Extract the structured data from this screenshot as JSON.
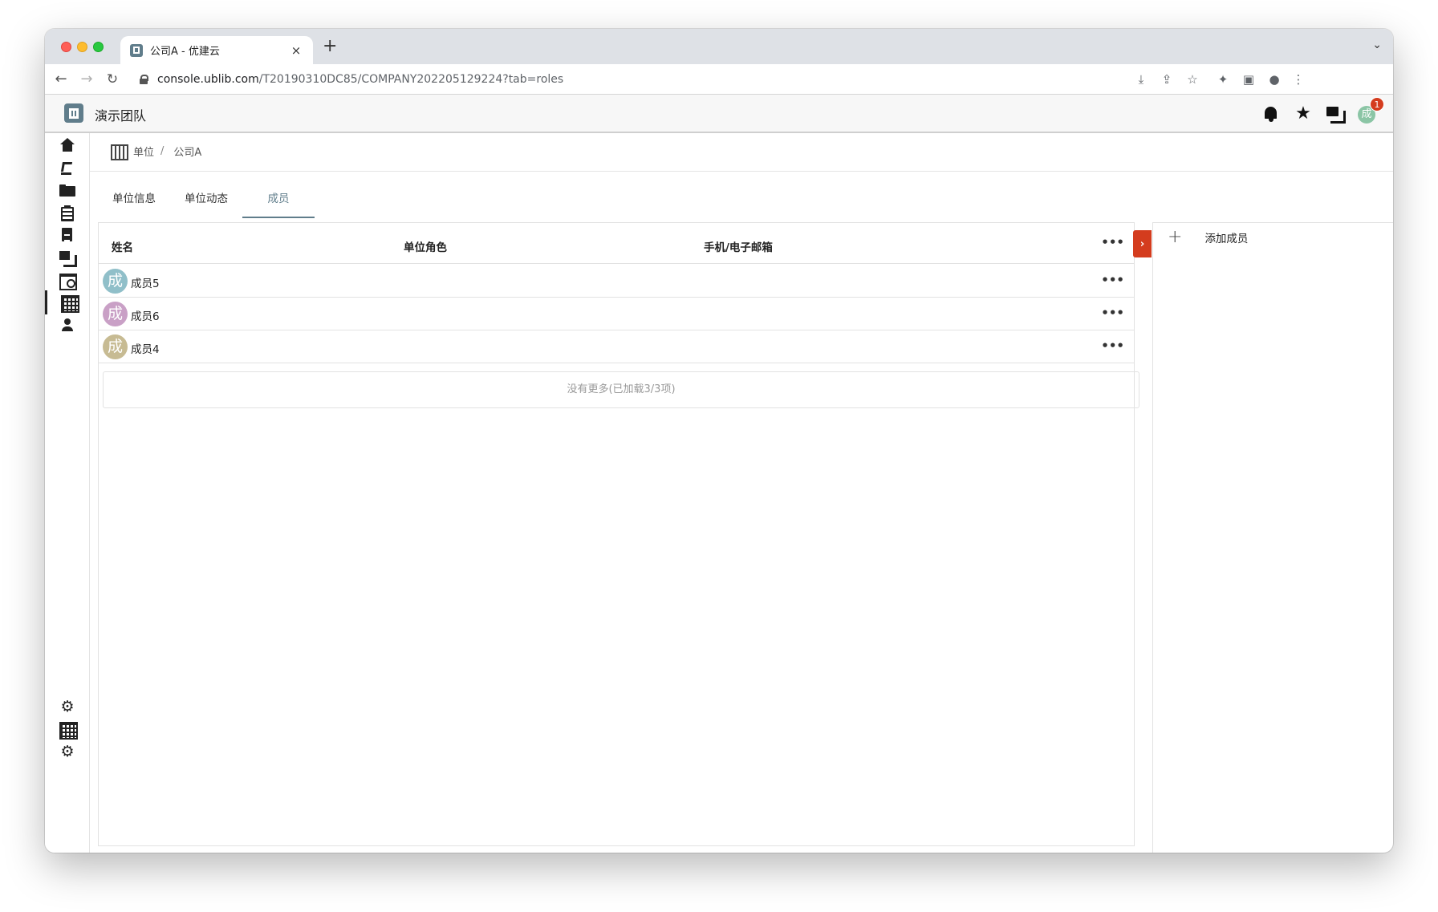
{
  "browser": {
    "tab_title": "公司A - 优建云",
    "tab_close": "×",
    "new_tab": "+",
    "tab_menu": "⌄",
    "url_host": "console.ublib.com",
    "url_path": "/T20190310DC85/COMPANY202205129224?tab=roles",
    "nav": {
      "back": "←",
      "forward": "→",
      "reload": "↻"
    }
  },
  "app": {
    "team_name": "演示团队",
    "user_initial": "成",
    "notification_count": "1",
    "star": "★"
  },
  "breadcrumb": {
    "root": "单位",
    "sep": "/",
    "current": "公司A"
  },
  "tabs": [
    {
      "label": "单位信息"
    },
    {
      "label": "单位动态"
    },
    {
      "label": "成员"
    }
  ],
  "active_tab": "成员",
  "table": {
    "columns": {
      "name": "姓名",
      "role": "单位角色",
      "contact": "手机/电子邮箱"
    },
    "rows": [
      {
        "initial": "成",
        "name": "成员5",
        "avatar_color": "#90bfc9"
      },
      {
        "initial": "成",
        "name": "成员6",
        "avatar_color": "#c9a0c6"
      },
      {
        "initial": "成",
        "name": "成员4",
        "avatar_color": "#c7bb93"
      }
    ],
    "more": "•••",
    "empty_text": "没有更多(已加载3/3项)"
  },
  "side_panel": {
    "add_label": "添加成员",
    "plus": "+"
  },
  "collapse": "›",
  "colors": {
    "accent": "#607d8b",
    "alert": "#d43c1e"
  }
}
